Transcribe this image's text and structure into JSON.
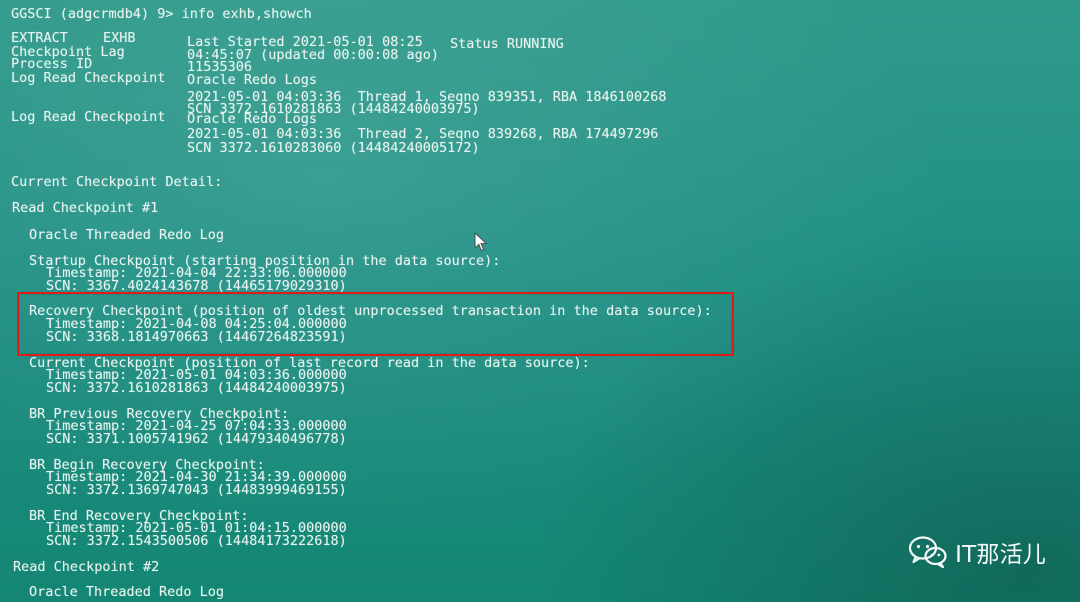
{
  "terminal": {
    "prompt_line": "GGSCI (adgcrmdb4) 9> info exhb,showch",
    "summary": {
      "extract_label": "EXTRACT",
      "extract_name": "EXHB",
      "last_started": "Last Started 2021-05-01 08:25",
      "status": "Status RUNNING",
      "checkpoint_lag_label": "Checkpoint Lag",
      "checkpoint_lag_value": "04:45:07 (updated 00:00:08 ago)",
      "process_id_label": "Process ID",
      "process_id_value": "11535306",
      "log_read_checkpoint_1": {
        "label": "Log Read Checkpoint",
        "source": "Oracle Redo Logs",
        "detail": "2021-05-01 04:03:36  Thread 1, Seqno 839351, RBA 1846100268",
        "scn": "SCN 3372.1610281863 (14484240003975)"
      },
      "log_read_checkpoint_2": {
        "label": "Log Read Checkpoint",
        "source": "Oracle Redo Logs",
        "detail": "2021-05-01 04:03:36  Thread 2, Seqno 839268, RBA 174497296",
        "scn": "SCN 3372.1610283060 (14484240005172)"
      }
    },
    "current_checkpoint_detail": "Current Checkpoint Detail:",
    "read_checkpoint_1": "Read Checkpoint #1",
    "oracle_threaded_redo_log_1": "Oracle Threaded Redo Log",
    "startup_checkpoint": {
      "title": "Startup Checkpoint (starting position in the data source):",
      "timestamp": "Timestamp: 2021-04-04 22:33:06.000000",
      "scn": "SCN: 3367.4024143678 (14465179029310)"
    },
    "recovery_checkpoint": {
      "title": "Recovery Checkpoint (position of oldest unprocessed transaction in the data source):",
      "timestamp": "Timestamp: 2021-04-08 04:25:04.000000",
      "scn": "SCN: 3368.1814970663 (14467264823591)"
    },
    "current_checkpoint": {
      "title": "Current Checkpoint (position of last record read in the data source):",
      "timestamp": "Timestamp: 2021-05-01 04:03:36.000000",
      "scn": "SCN: 3372.1610281863 (14484240003975)"
    },
    "br_previous": {
      "title": "BR Previous Recovery Checkpoint:",
      "timestamp": "Timestamp: 2021-04-25 07:04:33.000000",
      "scn": "SCN: 3371.1005741962 (14479340496778)"
    },
    "br_begin": {
      "title": "BR Begin Recovery Checkpoint:",
      "timestamp": "Timestamp: 2021-04-30 21:34:39.000000",
      "scn": "SCN: 3372.1369747043 (14483999469155)"
    },
    "br_end": {
      "title": "BR End Recovery Checkpoint:",
      "timestamp": "Timestamp: 2021-05-01 01:04:15.000000",
      "scn": "SCN: 3372.1543500506 (14484173222618)"
    },
    "read_checkpoint_2": "Read Checkpoint #2",
    "oracle_threaded_redo_log_2": "Oracle Threaded Redo Log"
  },
  "overlay": {
    "highlight_color": "#e31a1a",
    "cursor_icon": "mouse-pointer-icon"
  },
  "watermark": {
    "icon": "wechat-icon",
    "text": "IT那活儿"
  }
}
